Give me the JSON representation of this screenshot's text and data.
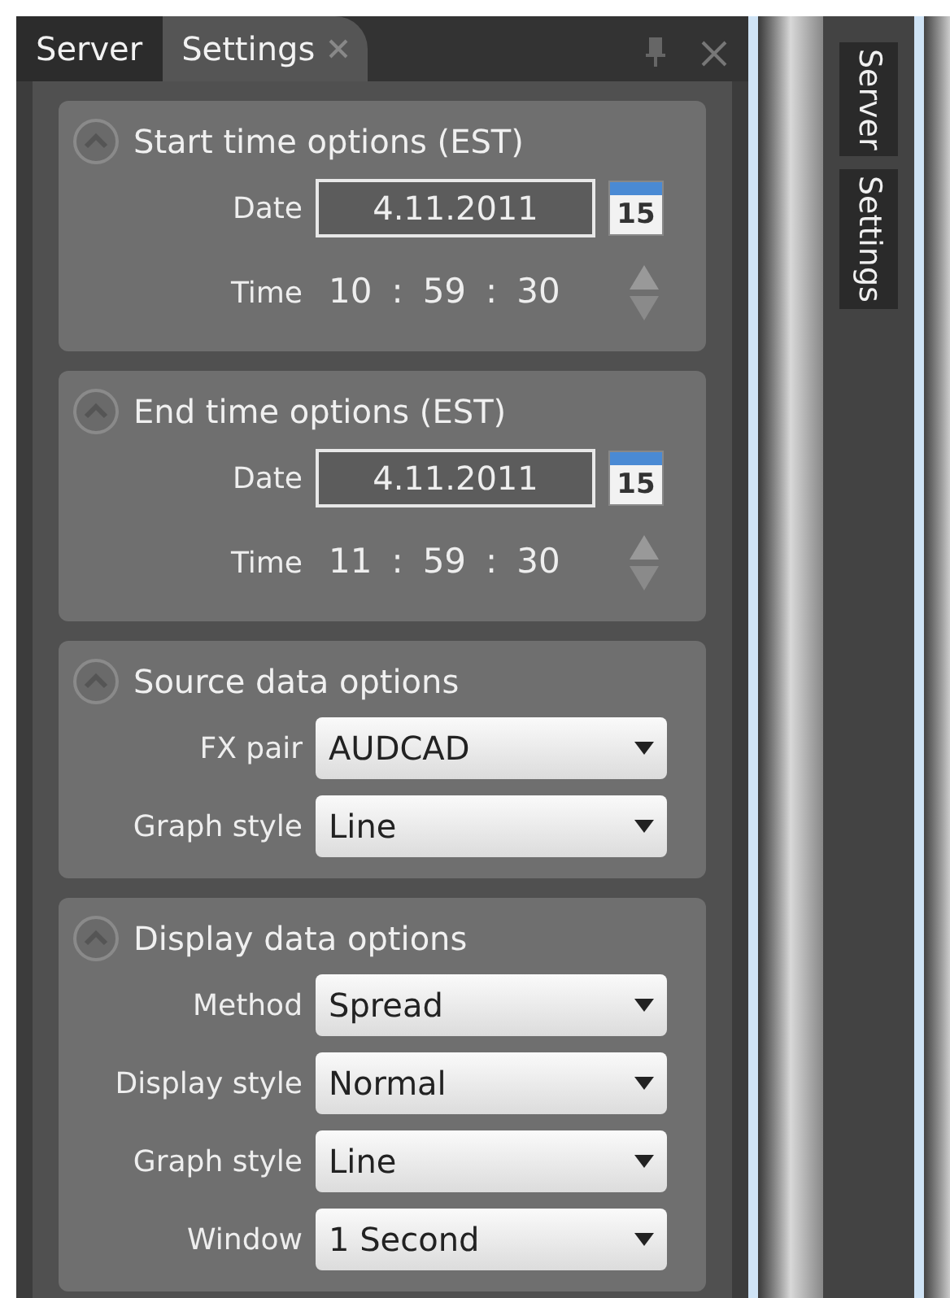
{
  "tabs": [
    {
      "label": "Server",
      "selected": false,
      "closable": false
    },
    {
      "label": "Settings",
      "selected": true,
      "closable": true
    }
  ],
  "sections": [
    {
      "title": "Start time options (EST)",
      "expanded": true,
      "rows": [
        {
          "kind": "date",
          "label": "Date",
          "value": "4.11.2011",
          "calendar_day": "15"
        },
        {
          "kind": "time",
          "label": "Time",
          "hours": "10",
          "minutes": "59",
          "seconds": "30",
          "separator": ":"
        }
      ]
    },
    {
      "title": "End time options (EST)",
      "expanded": true,
      "rows": [
        {
          "kind": "date",
          "label": "Date",
          "value": "4.11.2011",
          "calendar_day": "15"
        },
        {
          "kind": "time",
          "label": "Time",
          "hours": "11",
          "minutes": "59",
          "seconds": "30",
          "separator": ":"
        }
      ]
    },
    {
      "title": "Source data options",
      "expanded": true,
      "rows": [
        {
          "kind": "select",
          "label": "FX pair",
          "value": "AUDCAD"
        },
        {
          "kind": "select",
          "label": "Graph style",
          "value": "Line"
        }
      ]
    },
    {
      "title": "Display data options",
      "expanded": true,
      "rows": [
        {
          "kind": "select",
          "label": "Method",
          "value": "Spread"
        },
        {
          "kind": "select",
          "label": "Display style",
          "value": "Normal"
        },
        {
          "kind": "select",
          "label": "Graph style",
          "value": "Line"
        },
        {
          "kind": "select",
          "label": "Window",
          "value": "1 Second"
        }
      ]
    }
  ],
  "side_tabs": [
    {
      "label": "Server"
    },
    {
      "label": "Settings"
    }
  ]
}
